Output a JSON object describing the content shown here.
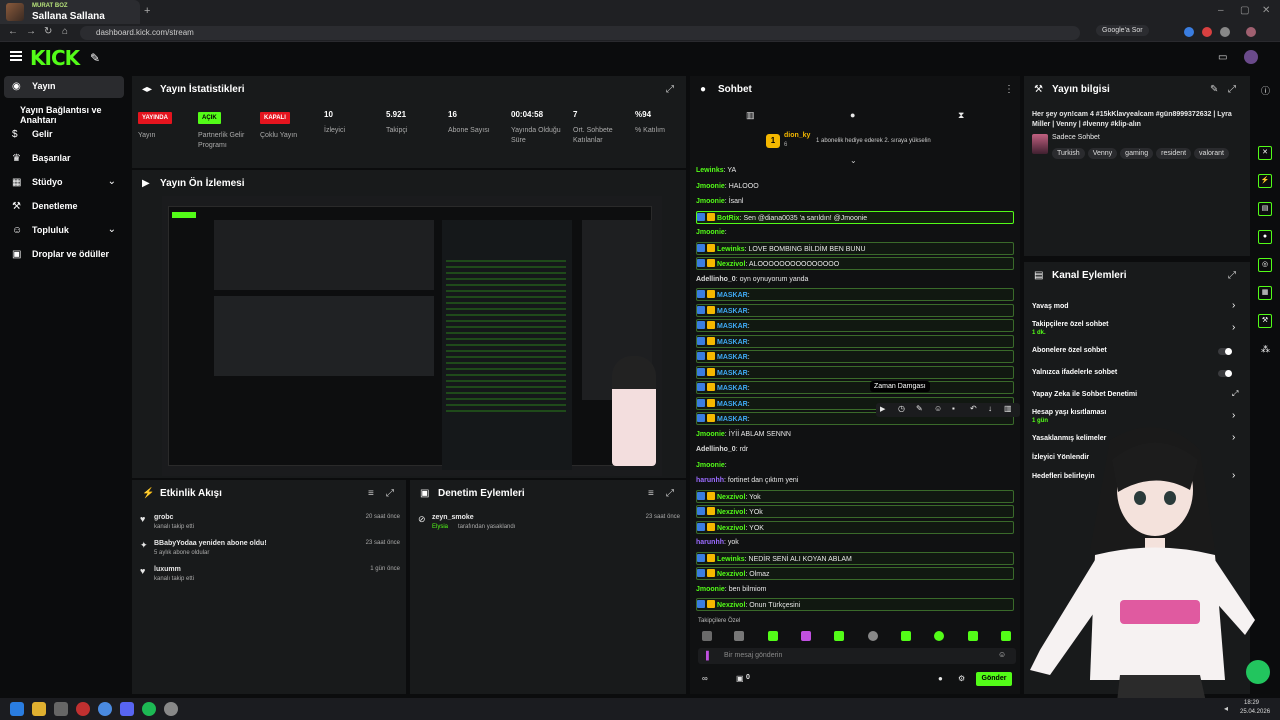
{
  "browser": {
    "tab_channel": "MURAT BOZ",
    "tab_title": "Sallana Sallana",
    "url": "dashboard.kick.com/stream",
    "google": "Google'a Sor"
  },
  "sidebar": {
    "items": [
      {
        "label": "Yayın"
      },
      {
        "label": "Yayın Bağlantısı ve Anahtarı"
      },
      {
        "label": "Gelir"
      },
      {
        "label": "Başarılar"
      },
      {
        "label": "Stüdyo"
      },
      {
        "label": "Denetleme"
      },
      {
        "label": "Topluluk"
      },
      {
        "label": "Droplar ve ödüller"
      }
    ]
  },
  "stats": {
    "title": "Yayın İstatistikleri",
    "items": [
      {
        "badge": "YAYINDA",
        "label": "Yayın",
        "color": "#e5141e"
      },
      {
        "badge": "AÇIK",
        "label": "Partnerlik Gelir Programı",
        "color": "#53fc18"
      },
      {
        "badge": "KAPALI",
        "label": "Çoklu Yayın",
        "color": "#e5141e"
      },
      {
        "value": "10",
        "label": "İzleyici"
      },
      {
        "value": "5.921",
        "label": "Takipçi"
      },
      {
        "value": "16",
        "label": "Abone Sayısı"
      },
      {
        "value": "00:04:58",
        "label": "Yayında Olduğu Süre"
      },
      {
        "value": "7",
        "label": "Ort. Sohbete Katılanlar"
      },
      {
        "value": "%94",
        "label": "% Katılım"
      }
    ]
  },
  "preview": {
    "title": "Yayın Ön İzlemesi"
  },
  "activity": {
    "title": "Etkinlik Akışı",
    "items": [
      {
        "name": "grobc",
        "desc": "kanalı takip etti",
        "time": "20 saat önce"
      },
      {
        "name": "BBabyYodaa yeniden abone oldu!",
        "desc": "5 aylık abone oldular",
        "time": "23 saat önce"
      },
      {
        "name": "luxumm",
        "desc": "kanalı takip etti",
        "time": "1 gün önce"
      }
    ]
  },
  "moderation": {
    "title": "Denetim Eylemleri",
    "items": [
      {
        "name": "zeyn_smoke",
        "actor": "Elysia",
        "desc": "tarafından yasaklandı",
        "time": "23 saat önce"
      }
    ]
  },
  "chat": {
    "title": "Sohbet",
    "gift_user": "dion_ky",
    "gift_count": "6",
    "gift_text": "1 abonelik hediye ederek 2. sıraya yükselin",
    "tooltip": "Zaman Damgası",
    "followers_only": "Takipçilere Özel",
    "input_placeholder": "Bir mesaj gönderin",
    "send_label": "Gönder",
    "count": "0",
    "messages": [
      {
        "user": "Lewinks",
        "text": "YA",
        "color": "#53fc18",
        "hl": "none"
      },
      {
        "user": "Jmoonie",
        "text": "HALOOO",
        "color": "#53fc18",
        "hl": "none"
      },
      {
        "user": "Jmoonie",
        "text": "İsanl",
        "color": "#53fc18",
        "hl": "none"
      },
      {
        "user": "BotRix",
        "text": "Sen @diana0035 'a sarıldın! @Jmoonie",
        "color": "#53fc18",
        "hl": "strong"
      },
      {
        "user": "Jmoonie",
        "text": "",
        "color": "#53fc18",
        "hl": "none"
      },
      {
        "user": "Lewinks",
        "text": "LOVE BOMBING BİLDİM BEN BUNU",
        "color": "#53fc18",
        "hl": "soft"
      },
      {
        "user": "Nexzivol",
        "text": "ALOOOOOOOOOOOOOOO",
        "color": "#53fc18",
        "hl": "soft"
      },
      {
        "user": "Adellinho_0",
        "text": "oyn oynuyorum yanda",
        "color": "#dddddd",
        "hl": "none"
      },
      {
        "user": "MASKAR",
        "text": "",
        "color": "#3fa9f5",
        "hl": "soft"
      },
      {
        "user": "MASKAR",
        "text": "",
        "color": "#3fa9f5",
        "hl": "soft"
      },
      {
        "user": "MASKAR",
        "text": "",
        "color": "#3fa9f5",
        "hl": "soft"
      },
      {
        "user": "MASKAR",
        "text": "",
        "color": "#3fa9f5",
        "hl": "soft"
      },
      {
        "user": "MASKAR",
        "text": "",
        "color": "#3fa9f5",
        "hl": "soft"
      },
      {
        "user": "MASKAR",
        "text": "",
        "color": "#3fa9f5",
        "hl": "soft"
      },
      {
        "user": "MASKAR",
        "text": "",
        "color": "#3fa9f5",
        "hl": "soft"
      },
      {
        "user": "MASKAR",
        "text": "",
        "color": "#3fa9f5",
        "hl": "soft"
      },
      {
        "user": "MASKAR",
        "text": "",
        "color": "#3fa9f5",
        "hl": "soft"
      },
      {
        "user": "Jmoonie",
        "text": "İYİİ ABLAM SENNN",
        "color": "#53fc18",
        "hl": "none"
      },
      {
        "user": "Adellinho_0",
        "text": "rdr",
        "color": "#dddddd",
        "hl": "none"
      },
      {
        "user": "Jmoonie",
        "text": "",
        "color": "#53fc18",
        "hl": "none"
      },
      {
        "user": "harunhh",
        "text": "fortinet dan çıktım yeni",
        "color": "#9b6bff",
        "hl": "none"
      },
      {
        "user": "Nexzivol",
        "text": "Yok",
        "color": "#53fc18",
        "hl": "soft"
      },
      {
        "user": "Nexzivol",
        "text": "YOk",
        "color": "#53fc18",
        "hl": "soft"
      },
      {
        "user": "Nexzivol",
        "text": "YOK",
        "color": "#53fc18",
        "hl": "soft"
      },
      {
        "user": "harunhh",
        "text": "yok",
        "color": "#9b6bff",
        "hl": "none"
      },
      {
        "user": "Lewinks",
        "text": "NEDİR SENİ ALI KOYAN ABLAM",
        "color": "#53fc18",
        "hl": "soft"
      },
      {
        "user": "Nexzivol",
        "text": "Olmaz",
        "color": "#53fc18",
        "hl": "soft"
      },
      {
        "user": "Jmoonie",
        "text": "ben bilmiom",
        "color": "#53fc18",
        "hl": "none"
      },
      {
        "user": "Nexzivol",
        "text": "Onun Türkçesini",
        "color": "#53fc18",
        "hl": "soft"
      }
    ]
  },
  "stream_info": {
    "title": "Yayın bilgisi",
    "stream_title": "Her şey oyn!cam 4 #15kKlavyealcam #gün8999372632 | Lyra Miller | Venny | #lvenny #klip-alın",
    "category": "Sadece Sohbet",
    "tags": [
      "Turkish",
      "Venny",
      "gaming",
      "resident",
      "valorant"
    ]
  },
  "channel_actions": {
    "title": "Kanal Eylemleri",
    "options": [
      {
        "label": "Yavaş mod",
        "sub": "",
        "type": "chev"
      },
      {
        "label": "Takipçilere özel sohbet",
        "sub": "1 dk.",
        "type": "chev"
      },
      {
        "label": "Abonelere özel sohbet",
        "sub": "",
        "type": "toggle"
      },
      {
        "label": "Yalnızca ifadelerle sohbet",
        "sub": "",
        "type": "toggle"
      },
      {
        "label": "Yapay Zeka ile Sohbet Denetimi",
        "sub": "",
        "type": "ext"
      },
      {
        "label": "Hesap yaşı kısıtlaması",
        "sub": "1 gün",
        "type": "chev"
      },
      {
        "label": "Yasaklanmış kelimeler",
        "sub": "",
        "type": "chev"
      },
      {
        "label": "İzleyici Yönlendir",
        "sub": "",
        "type": "none"
      },
      {
        "label": "Hedefleri belirleyin",
        "sub": "",
        "type": "chev"
      }
    ]
  },
  "taskbar": {
    "time": "18:29",
    "date": "25.04.2026"
  },
  "colors": {
    "accent": "#53fc18",
    "live": "#e5141e"
  }
}
